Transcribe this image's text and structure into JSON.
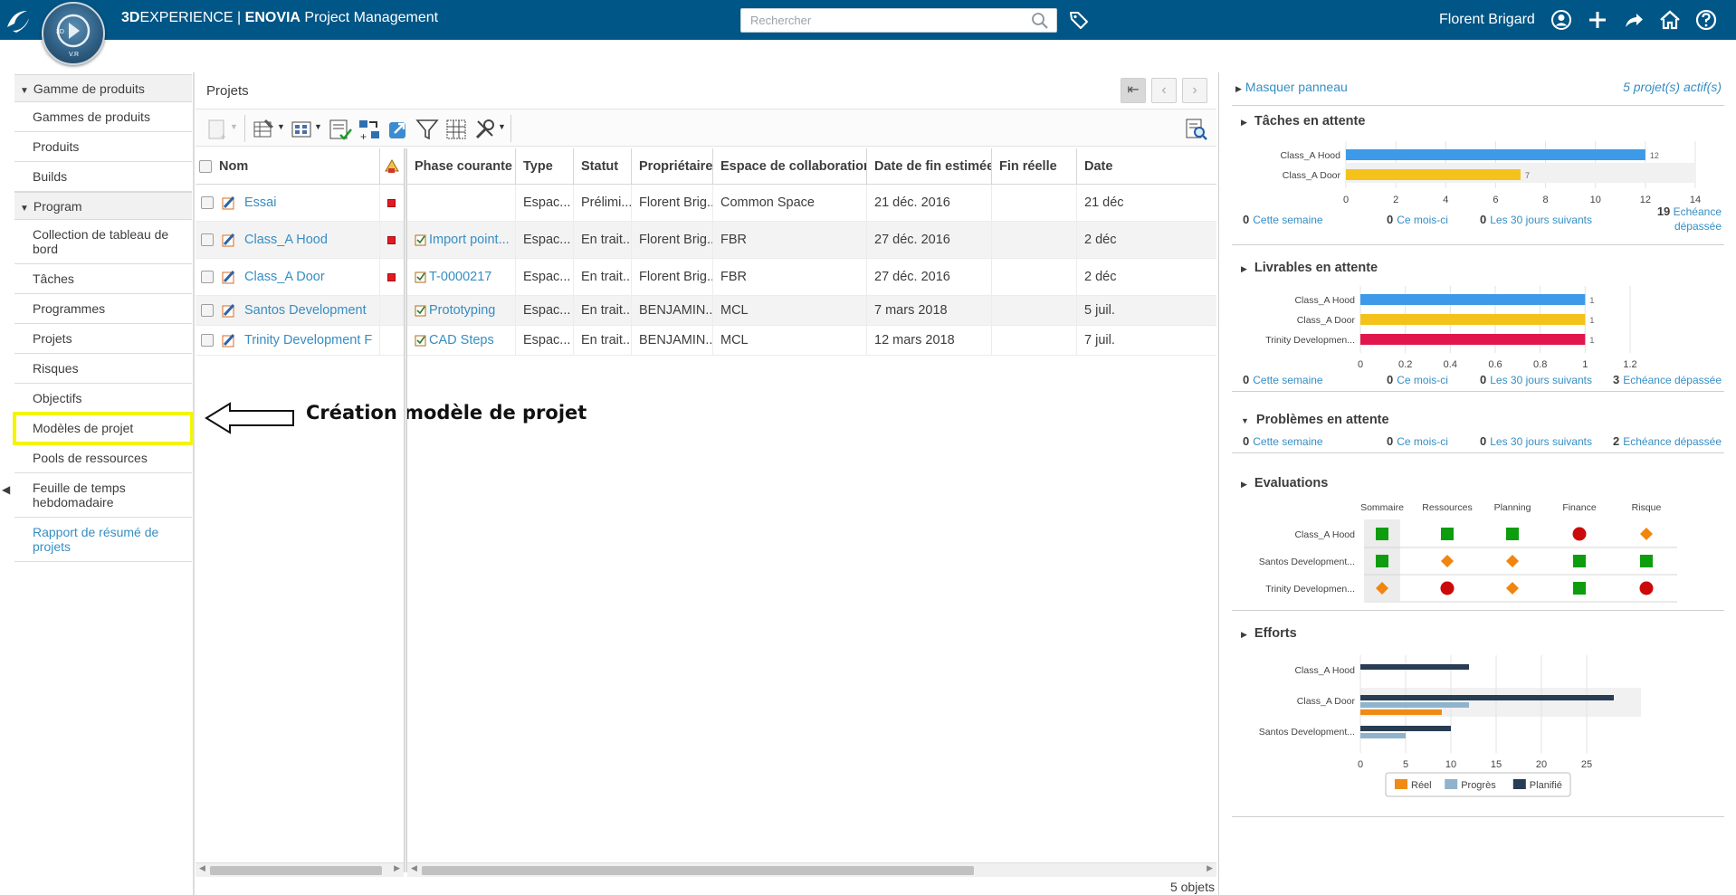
{
  "topbar": {
    "brand_bold": "3D",
    "brand_rest": "EXPERIENCE | ",
    "brand_app_bold": "ENOVIA",
    "brand_app_rest": " Project Management",
    "compass_label": "V.R",
    "compass_3d": "3D",
    "search_placeholder": "Rechercher",
    "user_name": "Florent Brigard",
    "bar_color": "#005686"
  },
  "leftnav": {
    "sections": [
      {
        "label": "Gamme de produits"
      },
      {
        "label": "Program"
      }
    ],
    "items_group1": [
      "Gammes de produits",
      "Produits",
      "Builds"
    ],
    "items_group2": [
      "Collection de tableau de bord",
      "Tâches",
      "Programmes",
      "Projets",
      "Risques",
      "Objectifs",
      "Modèles de projet",
      "Pools de ressources",
      "Feuille de temps hebdomadaire"
    ],
    "report_link": "Rapport de résumé de projets"
  },
  "annotation": {
    "text": "Création modèle de projet",
    "highlight_color": "#f5f500"
  },
  "center": {
    "title": "Projets",
    "frozen_header": "Nom",
    "columns": [
      "Phase courante",
      "Type",
      "Statut",
      "Propriétaire",
      "Espace de collaboration",
      "Date de fin estimée",
      "Fin réelle",
      "Date"
    ],
    "rows": [
      {
        "name": "Essai",
        "flag": true,
        "phase": "",
        "type": "Espac...",
        "statut": "Prélimi...",
        "owner": "Florent Brig...",
        "space": "Common Space",
        "end": "21 déc. 2016",
        "real": "",
        "date": "21 déc"
      },
      {
        "name": "Class_A Hood",
        "flag": true,
        "phase": "Import point...",
        "type": "Espac...",
        "statut": "En trait...",
        "owner": "Florent Brig...",
        "space": "FBR",
        "end": "27 déc. 2016",
        "real": "",
        "date": "2 déc"
      },
      {
        "name": "Class_A Door",
        "flag": true,
        "phase": "T-0000217",
        "type": "Espac...",
        "statut": "En trait...",
        "owner": "Florent Brig...",
        "space": "FBR",
        "end": "27 déc. 2016",
        "real": "",
        "date": "2 déc"
      },
      {
        "name": "Santos Development",
        "flag": false,
        "phase": "Prototyping",
        "type": "Espac...",
        "statut": "En trait...",
        "owner": "BENJAMIN...",
        "space": "MCL",
        "end": "7 mars 2018",
        "real": "",
        "date": "5 juil."
      },
      {
        "name": "Trinity Development F",
        "flag": false,
        "phase": "CAD Steps",
        "type": "Espac...",
        "statut": "En trait...",
        "owner": "BENJAMIN...",
        "space": "MCL",
        "end": "12 mars 2018",
        "real": "",
        "date": "7 juil."
      }
    ],
    "footer": "5 objets"
  },
  "right": {
    "hide_label": "Masquer panneau",
    "active_count": "5 projet(s) actif(s)",
    "sections": {
      "taches": "Tâches en attente",
      "livrables": "Livrables en attente",
      "problemes": "Problèmes en attente",
      "evaluations": "Evaluations",
      "efforts": "Efforts"
    },
    "stat_labels": {
      "week": "Cette semaine",
      "month": "Ce mois-ci",
      "next30": "Les 30 jours suivants",
      "overdue": "Echéance dépassée",
      "overdue_a": "Echéance",
      "overdue_b": "dépassée"
    },
    "taches_stats": {
      "week": "0",
      "month": "0",
      "next30": "0",
      "overdue": "19"
    },
    "livrables_stats": {
      "week": "0",
      "month": "0",
      "next30": "0",
      "overdue": "3"
    },
    "problemes_stats": {
      "week": "0",
      "month": "0",
      "next30": "0",
      "overdue": "2"
    },
    "eval": {
      "columns": [
        "Sommaire",
        "Ressources",
        "Planning",
        "Finance",
        "Risque"
      ],
      "rows": [
        {
          "label": "Class_A Hood",
          "marks": [
            "green",
            "green",
            "green",
            "red",
            "orange"
          ]
        },
        {
          "label": "Santos Development...",
          "marks": [
            "green",
            "orange",
            "orange",
            "green",
            "green"
          ]
        },
        {
          "label": "Trinity Developmen...",
          "marks": [
            "orange",
            "red",
            "orange",
            "green",
            "red"
          ]
        }
      ],
      "colors": {
        "green": "#0e9d0e",
        "red": "#cc0a0a",
        "orange": "#f0850f"
      }
    }
  },
  "chart_data": [
    {
      "type": "bar",
      "title": "Tâches en attente",
      "orientation": "horizontal",
      "categories": [
        "Class_A Hood",
        "Class_A Door"
      ],
      "values": [
        12,
        7
      ],
      "colors": [
        "#3d9ae8",
        "#f5c21b"
      ],
      "xlim": [
        0,
        14
      ],
      "xticks": [
        0,
        2,
        4,
        6,
        8,
        10,
        12,
        14
      ],
      "grid": true
    },
    {
      "type": "bar",
      "title": "Livrables en attente",
      "orientation": "horizontal",
      "categories": [
        "Class_A Hood",
        "Class_A Door",
        "Trinity Developmen..."
      ],
      "values": [
        1,
        1,
        1
      ],
      "colors": [
        "#3d9ae8",
        "#f5c21b",
        "#e0164c"
      ],
      "xlim": [
        0,
        1.2
      ],
      "xticks": [
        "0",
        "0.2",
        "0.4",
        "0.6",
        "0.8",
        "1",
        "1.2"
      ],
      "grid": true
    },
    {
      "type": "bar",
      "title": "Efforts",
      "orientation": "horizontal",
      "categories": [
        "Class_A Hood",
        "Class_A Door",
        "Santos Development..."
      ],
      "series": [
        {
          "name": "Planifié",
          "values": [
            12,
            28,
            10
          ],
          "color": "#283c52"
        },
        {
          "name": "Progrès",
          "values": [
            0,
            12,
            5
          ],
          "color": "#8fb3cc"
        },
        {
          "name": "Réel",
          "values": [
            0,
            9,
            0
          ],
          "color": "#ef8a14"
        }
      ],
      "legend_order": [
        "Réel",
        "Progrès",
        "Planifié"
      ],
      "xlim": [
        0,
        30
      ],
      "xticks": [
        0,
        5,
        10,
        15,
        20,
        25
      ],
      "legend": "bottom",
      "grid": true
    }
  ]
}
